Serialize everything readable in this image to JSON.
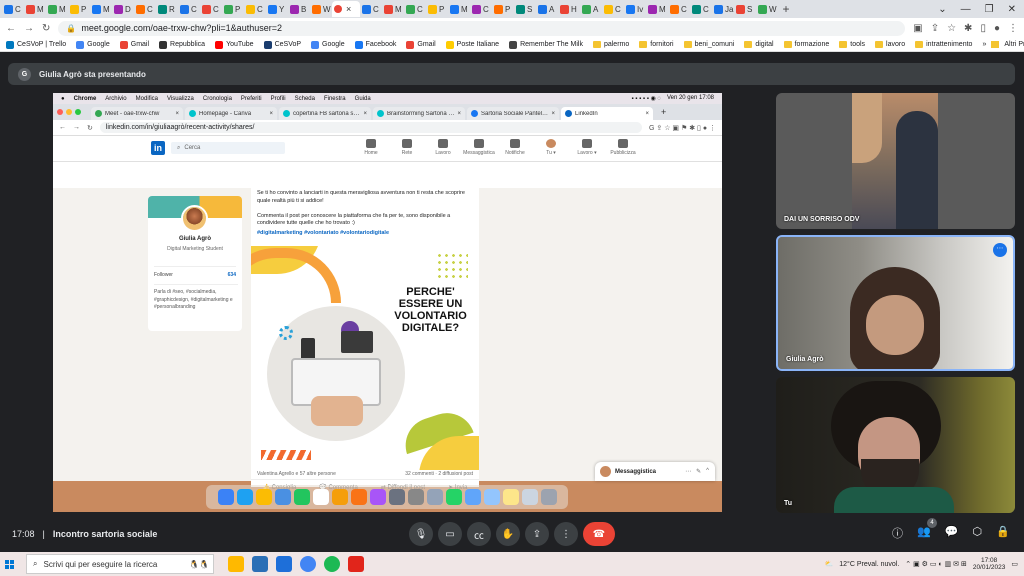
{
  "outer_tabs": [
    "C",
    "M",
    "M",
    "P",
    "M",
    "D",
    "C",
    "R",
    "C",
    "C",
    "P",
    "C",
    "Y",
    "B",
    "W",
    "",
    "C",
    "M",
    "C",
    "P",
    "M",
    "C",
    "P",
    "S",
    "A",
    "H",
    "A",
    "C",
    "Iv",
    "M",
    "C",
    "C",
    "Ja",
    "S",
    "W"
  ],
  "active_tab_icon": "meet-record-icon",
  "outer_url": "meet.google.com/oae-trxw-chw?pli=1&authuser=2",
  "bookmarks": [
    {
      "label": "CeSVoP | Trello",
      "color": "#0079bf",
      "kind": "icon"
    },
    {
      "label": "Google",
      "color": "#4285f4",
      "kind": "icon"
    },
    {
      "label": "Gmail",
      "color": "#ea4335",
      "kind": "icon"
    },
    {
      "label": "Repubblica",
      "color": "#333333",
      "kind": "icon"
    },
    {
      "label": "YouTube",
      "color": "#ff0000",
      "kind": "icon"
    },
    {
      "label": "CeSVoP",
      "color": "#1a3c6e",
      "kind": "icon"
    },
    {
      "label": "Google",
      "color": "#4285f4",
      "kind": "icon"
    },
    {
      "label": "Facebook",
      "color": "#1877f2",
      "kind": "icon"
    },
    {
      "label": "Gmail",
      "color": "#ea4335",
      "kind": "icon"
    },
    {
      "label": "Poste Italiane",
      "color": "#ffcc00",
      "kind": "icon"
    },
    {
      "label": "Remember The Milk",
      "color": "#444444",
      "kind": "icon"
    },
    {
      "label": "palermo",
      "kind": "folder"
    },
    {
      "label": "fornitori",
      "kind": "folder"
    },
    {
      "label": "beni_comuni",
      "kind": "folder"
    },
    {
      "label": "digital",
      "kind": "folder"
    },
    {
      "label": "formazione",
      "kind": "folder"
    },
    {
      "label": "tools",
      "kind": "folder"
    },
    {
      "label": "lavoro",
      "kind": "folder"
    },
    {
      "label": "intrattenimento",
      "kind": "folder"
    }
  ],
  "bookmarks_more": "»",
  "bookmarks_other": "Altri Preferiti",
  "presenter": {
    "avatar": "G",
    "text": "Giulia Agrò sta presentando"
  },
  "mac_menu": {
    "items": [
      "Chrome",
      "Archivio",
      "Modifica",
      "Visualizza",
      "Cronologia",
      "Preferiti",
      "Profili",
      "Scheda",
      "Finestra",
      "Guida"
    ],
    "clock": "Ven 20 gen  17:08"
  },
  "inner_tabs": [
    {
      "label": "Meet - oae-trxw-chw",
      "color": "#34a853"
    },
    {
      "label": "Homepage - Canva",
      "color": "#00c4cc"
    },
    {
      "label": "copertina FB sartoria so...",
      "color": "#00c4cc"
    },
    {
      "label": "Brainstorming Sartoria s...",
      "color": "#00c4cc"
    },
    {
      "label": "Sartoria Sociale Pantelleria",
      "color": "#1877f2"
    },
    {
      "label": "LinkedIn",
      "color": "#0a66c2"
    }
  ],
  "inner_url": "linkedin.com/in/giuliaagrò/recent-activity/shares/",
  "linkedin": {
    "logo": "in",
    "search_placeholder": "Cerca",
    "nav": [
      "Home",
      "Rete",
      "Lavoro",
      "Messaggistica",
      "Notifiche",
      "Tu ▾",
      "Lavoro ▾",
      "Pubblicizza"
    ],
    "profile": {
      "name": "Giulia Agrò",
      "role": "Digital Marketing Student",
      "follower_label": "Follower",
      "follower_count": "634",
      "bio": "Parla di #seo, #socialmedia, #graphicdesign, #digitalmarketing e #personalbranding"
    },
    "post_text": "Se ti ho convinto a lanciarti in questa meravigliosa avventura non ti resta che scoprire quale realtà più ti si addice!\n\nCommenta il post per conoscere la piattaforma che fa per te, sono disponibile a condividere tutte quelle che ho trovato :)",
    "post_tags": "#digitalmarketing #volontariato #volontariodigitale",
    "post_headline": "PERCHE' ESSERE UN VOLONTARIO DIGITALE?",
    "reactions": "Valentina Agrello e 57 altre persone",
    "stats": "32 commenti · 2 diffusioni post",
    "actions": [
      "Consiglia",
      "Commenta",
      "Diffondi il post",
      "Invia"
    ],
    "messaging": "Messaggistica"
  },
  "participants": [
    {
      "name": "DAI UN SORRISO ODV"
    },
    {
      "name": "Giulia Agrò"
    },
    {
      "name": "Tu"
    }
  ],
  "meeting": {
    "time": "17:08",
    "name": "Incontro sartoria sociale",
    "people_count": "4"
  },
  "taskbar": {
    "search_placeholder": "Scrivi qui per eseguire la ricerca",
    "weather": "12°C  Preval. nuvol.",
    "time": "17:08",
    "date": "20/01/2023"
  },
  "colors": {
    "meet_bg": "#202124",
    "end_call": "#ea4335",
    "linkedin_blue": "#0a66c2",
    "presenting_border": "#8ab4f8"
  }
}
